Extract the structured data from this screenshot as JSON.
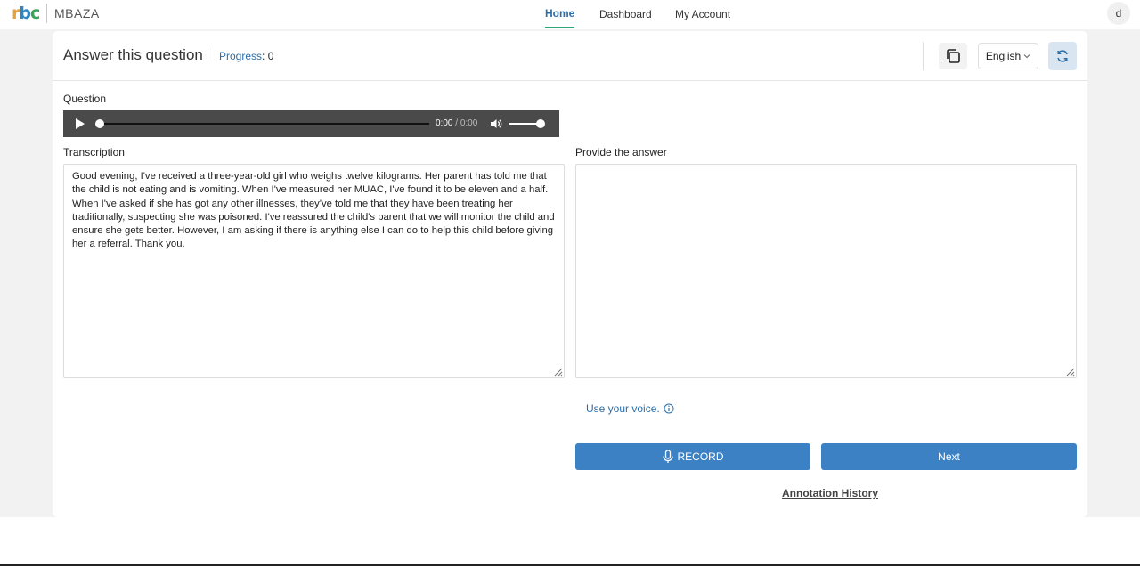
{
  "header": {
    "logo_text": "rbc",
    "app_name": "MBAZA",
    "nav": [
      {
        "label": "Home",
        "active": true
      },
      {
        "label": "Dashboard",
        "active": false
      },
      {
        "label": "My Account",
        "active": false
      }
    ],
    "avatar_initial": "d"
  },
  "card": {
    "title": "Answer this question",
    "progress_label": "Progress",
    "progress_value": "0",
    "language": "English",
    "icons": {
      "copy": "copy-icon",
      "refresh": "refresh-icon",
      "dropdown": "chevron-down-icon"
    }
  },
  "question": {
    "label": "Question",
    "audio": {
      "current_time": "0:00",
      "separator": "/",
      "duration": "0:00",
      "progress": 0,
      "volume": 0.9
    }
  },
  "transcription": {
    "label": "Transcription",
    "text": "Good evening, I've received a three-year-old girl who weighs twelve kilograms. Her parent has told me that the child is not eating and is vomiting. When I've measured her MUAC, I've found it to be eleven and a half. When I've asked if she has got any other illnesses, they've told me that they have been treating her traditionally, suspecting she was poisoned. I've reassured the child's parent that we will monitor the child and ensure she gets better. However, I am asking if there is anything else I can do to help this child before giving her a referral. Thank you."
  },
  "answer": {
    "label": "Provide the answer",
    "value": "",
    "voice_hint": "Use your voice.",
    "record_label": "RECORD",
    "next_label": "Next",
    "history_link": "Annotation History"
  },
  "colors": {
    "accent": "#3c81c4",
    "link": "#2d6ea8",
    "active_underline": "#2aa878",
    "logo_r": "#e8a13a",
    "logo_b": "#2e86c1",
    "logo_c": "#3aa35a"
  }
}
